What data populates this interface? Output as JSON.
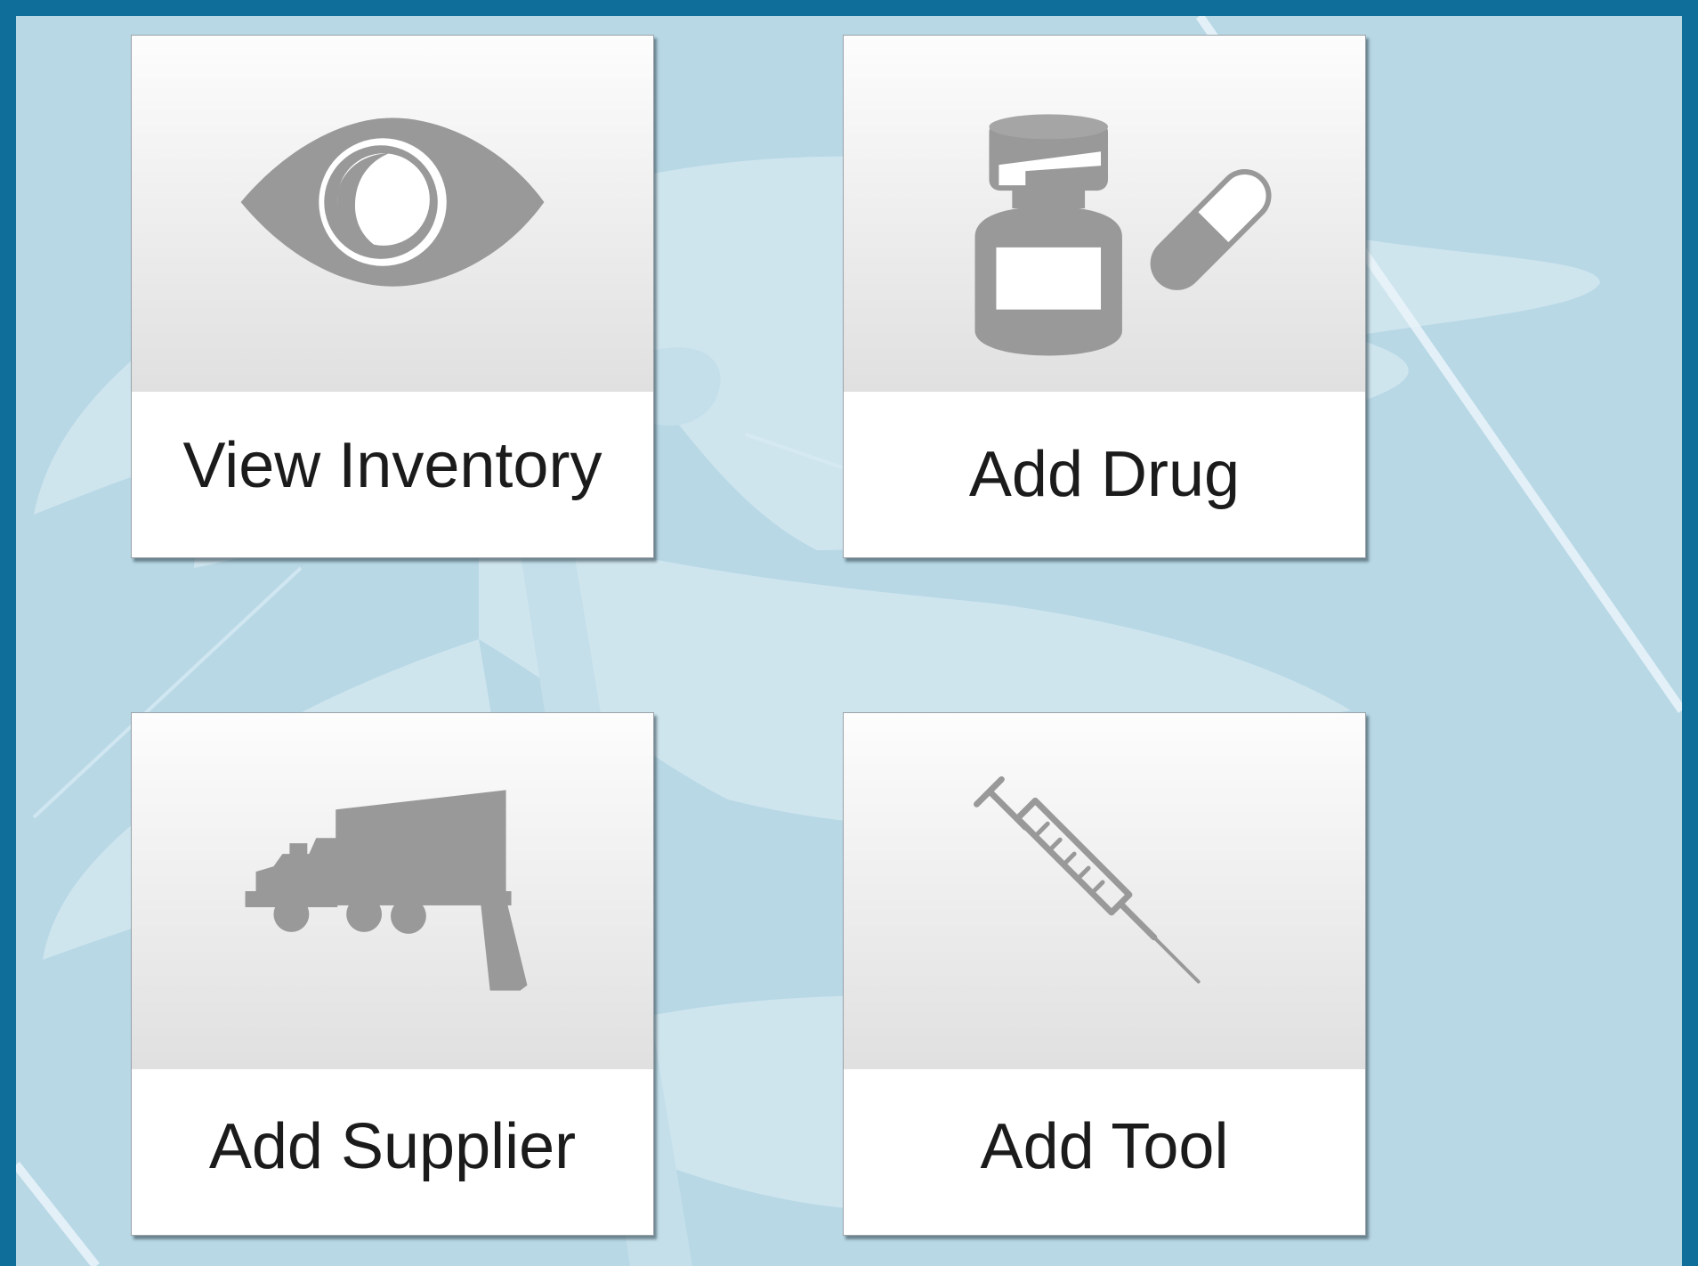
{
  "theme": {
    "outer_background": "#0f6e9a",
    "inner_background": "#b8d8e6",
    "icon_color": "#999999",
    "label_color": "#1b1b1b"
  },
  "tiles": [
    {
      "label": "View Inventory",
      "icon": "eye-icon"
    },
    {
      "label": "Add Drug",
      "icon": "medicine-bottle-pill-icon"
    },
    {
      "label": "Add Supplier",
      "icon": "delivery-truck-icon"
    },
    {
      "label": "Add Tool",
      "icon": "syringe-icon"
    }
  ]
}
